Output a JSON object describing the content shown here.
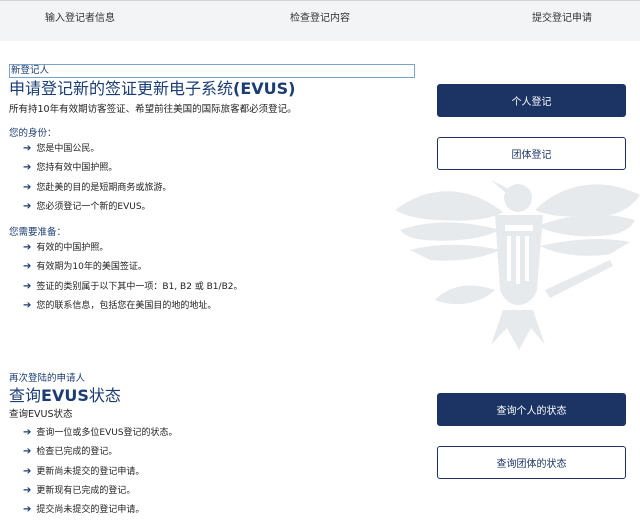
{
  "steps": [
    "输入登记者信息",
    "检查登记内容",
    "提交登记申请"
  ],
  "new": {
    "kicker": "新登记人",
    "title_prefix": "申请登记新的签证更新电子系统",
    "title_bold": "(EVUS)",
    "desc": "所有持10年有效期访客签证、希望前往美国的国际旅客都必须登记。",
    "identity_heading": "您的身份：",
    "identity_items": [
      "您是中国公民。",
      "您持有效中国护照。",
      "您赴美的目的是短期商务或旅游。",
      "您必须登记一个新的EVUS。"
    ],
    "prep_heading": "您需要准备：",
    "prep_items": [
      "有效的中国护照。",
      "有效期为10年的美国签证。",
      "签证的类别属于以下其中一项：B1, B2 或 B1/B2。",
      "您的联系信息，包括您在美国目的地的地址。"
    ]
  },
  "returning": {
    "kicker": "再次登陆的申请人",
    "title_prefix": "查询",
    "title_bold": "EVUS",
    "title_suffix": "状态",
    "sub": "查询EVUS状态",
    "items": [
      "查询一位或多位EVUS登记的状态。",
      "检查已完成的登记。",
      "更新尚未提交的登记申请。",
      "更新现有已完成的登记。",
      "提交尚未提交的登记申请。"
    ]
  },
  "buttons": {
    "individual": "个人登记",
    "group": "团体登记",
    "check_individual": "查询个人的状态",
    "check_group": "查询团体的状态"
  },
  "colors": {
    "navy": "#1b3464",
    "link_blue": "#1b3d74"
  },
  "icons": {
    "bullet": "arrow-right-icon",
    "seal": "eagle-seal-icon"
  }
}
